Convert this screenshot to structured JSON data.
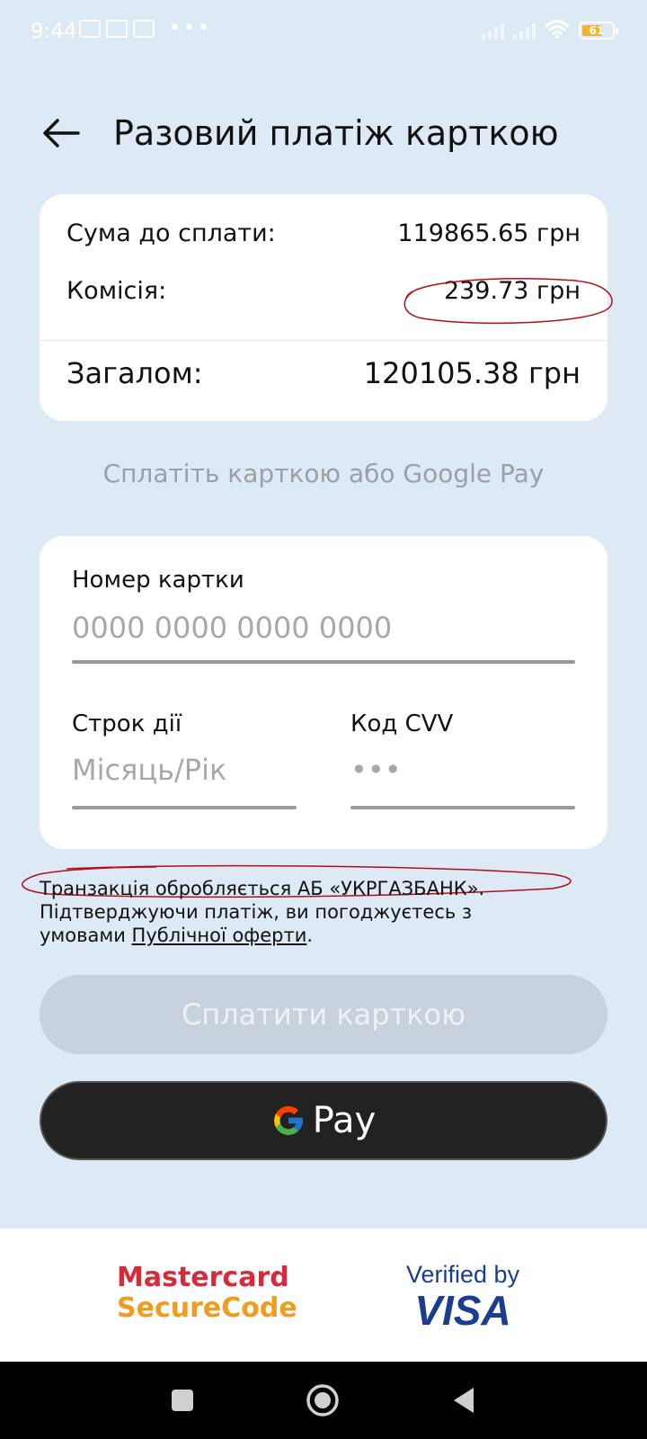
{
  "status_bar": {
    "time": "9:44",
    "battery": "61",
    "more": "•••"
  },
  "header": {
    "title": "Разовий платіж карткою"
  },
  "summary": {
    "amount_label": "Сума до сплати:",
    "amount_value": "119865.65 грн",
    "fee_label": "Комісія:",
    "fee_value": "239.73 грн",
    "total_label": "Загалом:",
    "total_value": "120105.38 грн"
  },
  "pay_hint": "Сплатіть карткою або Google Pay",
  "card_form": {
    "number_label": "Номер картки",
    "number_placeholder": "0000 0000 0000 0000",
    "expiry_label": "Строк дії",
    "expiry_placeholder": "Місяць/Рік",
    "cvv_label": "Код CVV",
    "cvv_placeholder": "•••"
  },
  "legal": {
    "line1": "Транзакція обробляється АБ «УКРГАЗБАНК».",
    "line2": "Підтверджуючи платіж, ви погоджуєтесь з",
    "line3_prefix": "умовами ",
    "offer_link": "Публічної оферти",
    "line3_suffix": "."
  },
  "buttons": {
    "pay_card": "Сплатити карткою",
    "gpay_text": "Pay"
  },
  "footer": {
    "mastercard_line1": "Mastercard",
    "mastercard_line2": "SecureCode",
    "visa_line1": "Verified by",
    "visa_line2": "VISA"
  },
  "colors": {
    "background": "#dde9f5",
    "card": "#ffffff",
    "annotation": "#b0101a",
    "mastercard_red": "#d72a3a",
    "mastercard_orange": "#ef9c1f",
    "visa_blue": "#1a3d8f"
  }
}
